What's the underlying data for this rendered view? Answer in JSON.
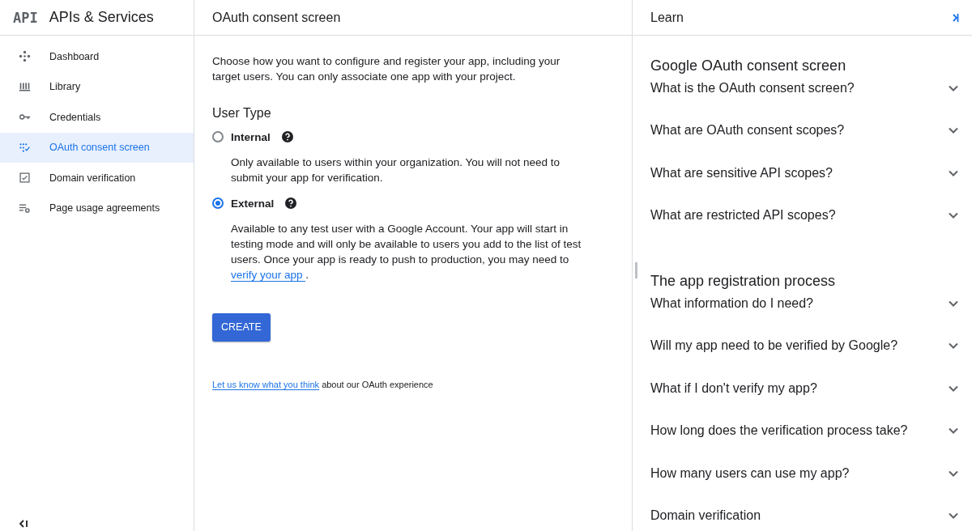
{
  "sidebar": {
    "logo": "API",
    "title": "APIs & Services",
    "items": [
      {
        "label": "Dashboard",
        "selected": false
      },
      {
        "label": "Library",
        "selected": false
      },
      {
        "label": "Credentials",
        "selected": false
      },
      {
        "label": "OAuth consent screen",
        "selected": true
      },
      {
        "label": "Domain verification",
        "selected": false
      },
      {
        "label": "Page usage agreements",
        "selected": false
      }
    ]
  },
  "main": {
    "title": "OAuth consent screen",
    "intro": "Choose how you want to configure and register your app, including your target users. You can only associate one app with your project.",
    "user_type_heading": "User Type",
    "options": [
      {
        "label": "Internal",
        "selected": false,
        "description": "Only available to users within your organization. You will not need to submit your app for verification."
      },
      {
        "label": "External",
        "selected": true,
        "description": "Available to any test user with a Google Account. Your app will start in testing mode and will only be available to users you add to the list of test users. Once your app is ready to push to production, you may need to ",
        "link": "verify your app ",
        "suffix": "."
      }
    ],
    "create_button": "CREATE",
    "feedback_link": "Let us know what you think",
    "feedback_text": " about our OAuth experience"
  },
  "learn": {
    "title": "Learn",
    "sections": [
      {
        "heading": "Google OAuth consent screen",
        "questions": [
          {
            "label": "What is the OAuth consent screen?",
            "expanded": false
          },
          {
            "label": "What are OAuth consent scopes?",
            "expanded": false
          },
          {
            "label": "What are sensitive API scopes?",
            "expanded": false
          },
          {
            "label": "What are restricted API scopes?",
            "expanded": false
          }
        ]
      },
      {
        "heading": "The app registration process",
        "questions": [
          {
            "label": "What information do I need?",
            "expanded": false
          },
          {
            "label": "Will my app need to be verified by Google?",
            "expanded": false
          },
          {
            "label": "What if I don't verify my app?",
            "expanded": false
          },
          {
            "label": "How long does the verification process take?",
            "expanded": false
          },
          {
            "label": "How many users can use my app?",
            "expanded": false
          },
          {
            "label": "Domain verification",
            "expanded": false
          }
        ]
      }
    ]
  }
}
